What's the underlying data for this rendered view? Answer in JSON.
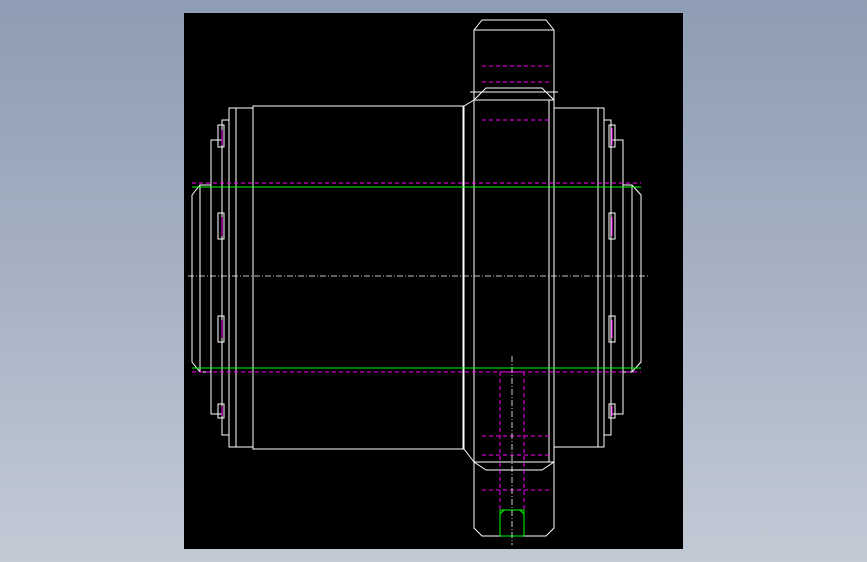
{
  "app": {
    "canvas_background": "#000000",
    "backdrop_top": "#8e9db3",
    "backdrop_bottom": "#c3cad6"
  },
  "drawing": {
    "line_colors": {
      "outline": "#ffffff",
      "hidden": "#ff00ff",
      "thread": "#00ff00",
      "centerline": "#ffffff"
    }
  }
}
